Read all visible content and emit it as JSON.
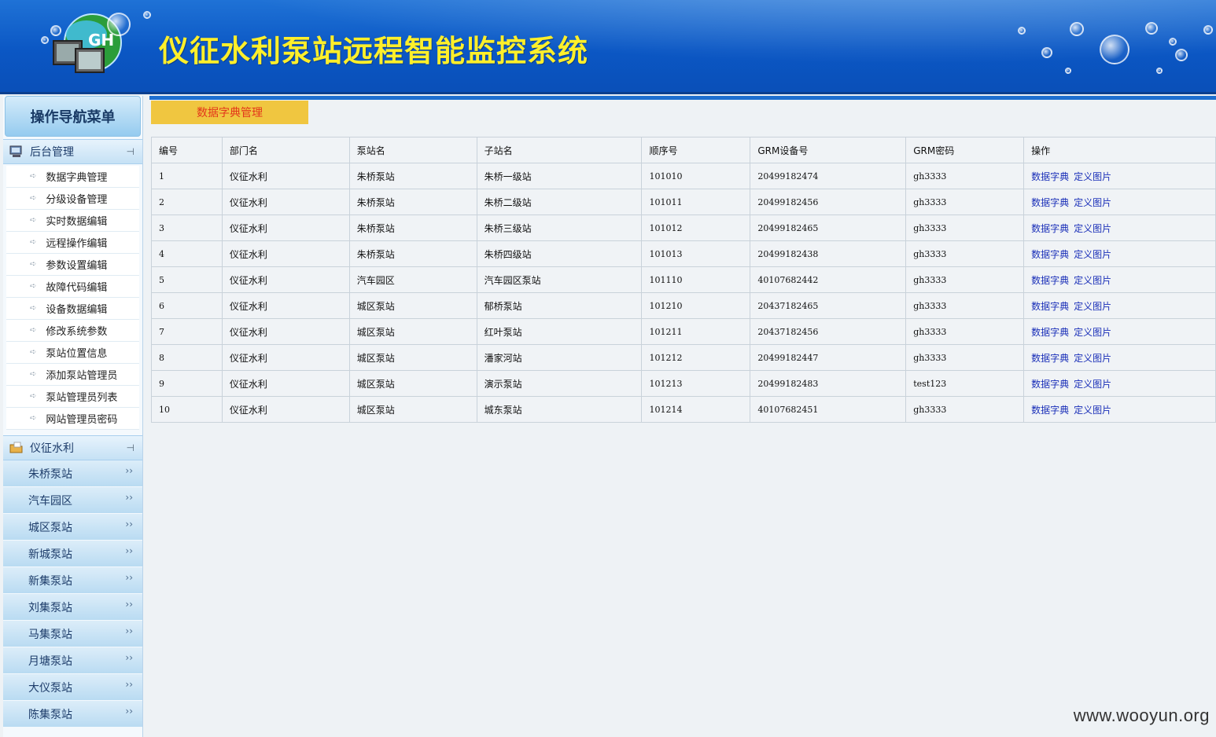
{
  "header": {
    "logo_text": "GH",
    "title": "仪征水利泵站远程智能监控系统"
  },
  "sidebar": {
    "nav_title": "操作导航菜单",
    "groups": [
      {
        "label": "后台管理",
        "icon": "monitor-icon",
        "items": [
          {
            "label": "数据字典管理"
          },
          {
            "label": "分级设备管理"
          },
          {
            "label": "实时数据编辑"
          },
          {
            "label": "远程操作编辑"
          },
          {
            "label": "参数设置编辑"
          },
          {
            "label": "故障代码编辑"
          },
          {
            "label": "设备数据编辑"
          },
          {
            "label": "修改系统参数"
          },
          {
            "label": "泵站位置信息"
          },
          {
            "label": "添加泵站管理员"
          },
          {
            "label": "泵站管理员列表"
          },
          {
            "label": "网站管理员密码"
          }
        ]
      },
      {
        "label": "仪征水利",
        "icon": "folder-icon"
      }
    ],
    "stations": [
      {
        "label": "朱桥泵站"
      },
      {
        "label": "汽车园区"
      },
      {
        "label": "城区泵站"
      },
      {
        "label": "新城泵站"
      },
      {
        "label": "新集泵站"
      },
      {
        "label": "刘集泵站"
      },
      {
        "label": "马集泵站"
      },
      {
        "label": "月塘泵站"
      },
      {
        "label": "大仪泵站"
      },
      {
        "label": "陈集泵站"
      }
    ]
  },
  "main": {
    "tab_label": "数据字典管理",
    "table": {
      "headers": [
        "编号",
        "部门名",
        "泵站名",
        "子站名",
        "顺序号",
        "GRM设备号",
        "GRM密码",
        "操作"
      ],
      "rows": [
        [
          "1",
          "仪征水利",
          "朱桥泵站",
          "朱桥一级站",
          "101010",
          "20499182474",
          "gh3333"
        ],
        [
          "2",
          "仪征水利",
          "朱桥泵站",
          "朱桥二级站",
          "101011",
          "20499182456",
          "gh3333"
        ],
        [
          "3",
          "仪征水利",
          "朱桥泵站",
          "朱桥三级站",
          "101012",
          "20499182465",
          "gh3333"
        ],
        [
          "4",
          "仪征水利",
          "朱桥泵站",
          "朱桥四级站",
          "101013",
          "20499182438",
          "gh3333"
        ],
        [
          "5",
          "仪征水利",
          "汽车园区",
          "汽车园区泵站",
          "101110",
          "40107682442",
          "gh3333"
        ],
        [
          "6",
          "仪征水利",
          "城区泵站",
          "郁桥泵站",
          "101210",
          "20437182465",
          "gh3333"
        ],
        [
          "7",
          "仪征水利",
          "城区泵站",
          "红叶泵站",
          "101211",
          "20437182456",
          "gh3333"
        ],
        [
          "8",
          "仪征水利",
          "城区泵站",
          "潘家河站",
          "101212",
          "20499182447",
          "gh3333"
        ],
        [
          "9",
          "仪征水利",
          "城区泵站",
          "演示泵站",
          "101213",
          "20499182483",
          "test123"
        ],
        [
          "10",
          "仪征水利",
          "城区泵站",
          "城东泵站",
          "101214",
          "40107682451",
          "gh3333"
        ]
      ],
      "ops": [
        "数据字典",
        "定义图片"
      ]
    }
  },
  "watermark": "www.wooyun.org",
  "colors": {
    "header_blue": "#0b57c4",
    "title_yellow": "#ffef2a",
    "tab_bg": "#f0c640",
    "tab_text": "#e3361b",
    "link": "#1a2fb8"
  }
}
